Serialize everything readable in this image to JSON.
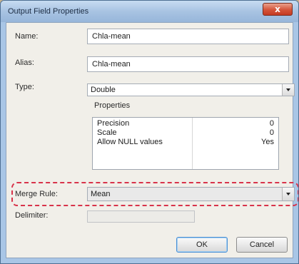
{
  "window": {
    "title": "Output Field Properties",
    "close_symbol": "x"
  },
  "fields": {
    "name": {
      "label": "Name:",
      "value": "Chla-mean"
    },
    "alias": {
      "label": "Alias:",
      "value": "Chla-mean"
    },
    "type": {
      "label": "Type:",
      "value": "Double"
    }
  },
  "properties": {
    "heading": "Properties",
    "rows": [
      {
        "name": "Precision",
        "value": "0"
      },
      {
        "name": "Scale",
        "value": "0"
      },
      {
        "name": "Allow NULL values",
        "value": "Yes"
      }
    ]
  },
  "merge_rule": {
    "label": "Merge Rule:",
    "value": "Mean",
    "highlight_color": "#d8334a"
  },
  "delimiter": {
    "label": "Delimiter:",
    "value": ""
  },
  "buttons": {
    "ok": "OK",
    "cancel": "Cancel"
  }
}
